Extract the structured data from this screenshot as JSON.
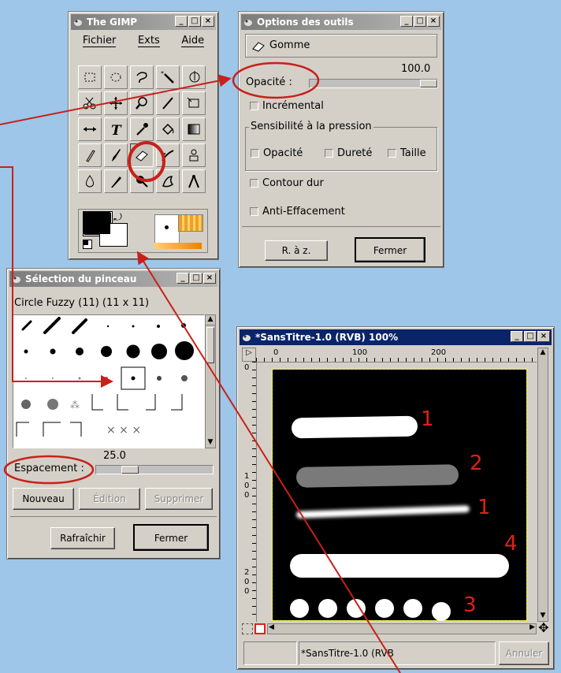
{
  "gimp": {
    "title": "The GIMP",
    "menu": [
      "Fichier",
      "Exts",
      "Aide"
    ],
    "tool_icons": [
      "rect-select-icon",
      "ellipse-select-icon",
      "lasso-icon",
      "magic-wand-icon",
      "bezier-select-icon",
      "scissors-icon",
      "move-icon",
      "zoom-icon",
      "crop-icon",
      "transform-icon",
      "flip-icon",
      "text-icon",
      "color-picker-icon",
      "bucket-fill-icon",
      "gradient-icon",
      "pencil-icon",
      "paintbrush-icon",
      "eraser-icon",
      "airbrush-icon",
      "clone-icon",
      "convolve-icon",
      "ink-icon",
      "dodge-burn-icon",
      "smudge-icon",
      "measure-icon"
    ]
  },
  "options": {
    "title": "Options des outils",
    "tool_name": "Gomme",
    "opacity_value": "100.0",
    "opacity_fraction": 1.0,
    "opacity_label": "Opacité :",
    "incremental_label": "Incrémental",
    "pressure_group": "Sensibilité à la pression",
    "pressure_opacity": "Opacité",
    "pressure_hardness": "Dureté",
    "pressure_size": "Taille",
    "hard_edge_label": "Contour dur",
    "anti_erase_label": "Anti-Effacement",
    "reset_button": "R. à z.",
    "close_button": "Fermer"
  },
  "brushes": {
    "title": "Sélection du pinceau",
    "brush_name": "Circle Fuzzy (11) (11 x 11)",
    "spacing_value": "25.0",
    "spacing_fraction": 0.25,
    "spacing_label": "Espacement :",
    "new_button": "Nouveau",
    "edit_button": "Édition",
    "delete_button": "Supprimer",
    "refresh_button": "Rafraîchir",
    "close_button": "Fermer"
  },
  "image": {
    "title": "*SansTitre-1.0 (RVB) 100%",
    "ruler_top": [
      "0",
      "100",
      "200"
    ],
    "ruler_left": [
      "0",
      "1",
      "0",
      "0",
      "2",
      "0",
      "0"
    ],
    "status_text": "*SansTitre-1.0 (RVB",
    "cancel_button": "Annuler",
    "stroke_labels": [
      "1",
      "2",
      "1",
      "4",
      "3"
    ]
  }
}
